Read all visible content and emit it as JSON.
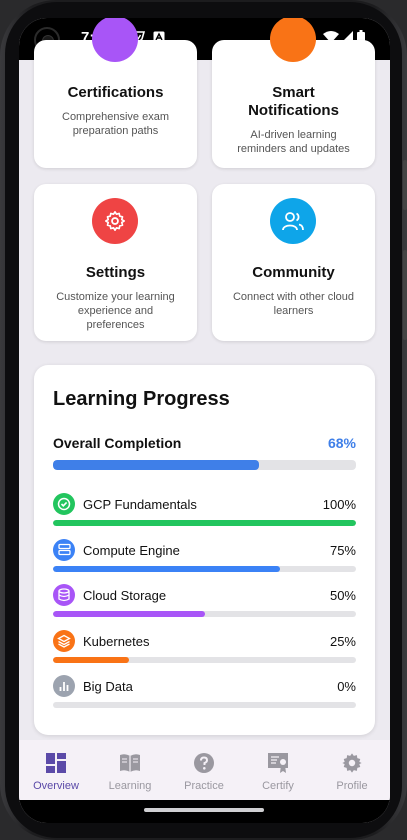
{
  "status_bar": {
    "time": "7:22",
    "icon_g": "G"
  },
  "cards": [
    {
      "title": "Certifications",
      "desc": "Comprehensive exam preparation paths"
    },
    {
      "title": "Smart Notifications",
      "desc": "AI-driven learning reminders and updates"
    },
    {
      "title": "Settings",
      "desc": "Customize your learning experience and preferences"
    },
    {
      "title": "Community",
      "desc": "Connect with other cloud learners"
    }
  ],
  "progress": {
    "title": "Learning Progress",
    "overall_label": "Overall Completion",
    "overall_value": "68%",
    "overall_fraction": 0.68,
    "items": [
      {
        "label": "GCP Fundamentals",
        "pct": "100%",
        "fraction": 1.0,
        "color": "#22c55e"
      },
      {
        "label": "Compute Engine",
        "pct": "75%",
        "fraction": 0.75,
        "color": "#3b82f6"
      },
      {
        "label": "Cloud Storage",
        "pct": "50%",
        "fraction": 0.5,
        "color": "#a855f7"
      },
      {
        "label": "Kubernetes",
        "pct": "25%",
        "fraction": 0.25,
        "color": "#f97316"
      },
      {
        "label": "Big Data",
        "pct": "0%",
        "fraction": 0,
        "color": "#9ca3af"
      }
    ]
  },
  "nav": [
    {
      "label": "Overview",
      "icon": "dashboard-icon",
      "active": true
    },
    {
      "label": "Learning",
      "icon": "book-icon",
      "active": false
    },
    {
      "label": "Practice",
      "icon": "help-circle-icon",
      "active": false
    },
    {
      "label": "Certify",
      "icon": "badge-icon",
      "active": false
    },
    {
      "label": "Profile",
      "icon": "gear-icon",
      "active": false
    }
  ],
  "colors": {
    "accent_blue": "#3f7fe8",
    "nav_active": "#5b4aa8",
    "settings_red": "#ef4444",
    "community_blue": "#0ea5e9"
  }
}
